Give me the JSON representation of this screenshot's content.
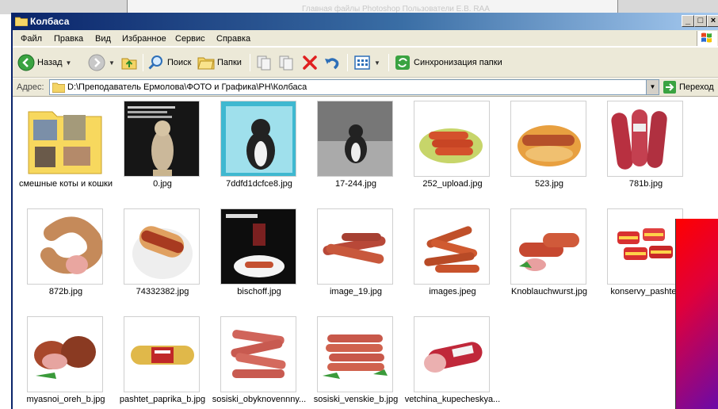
{
  "window": {
    "title": "Колбаса",
    "min_label": "_",
    "max_label": "□",
    "close_label": "×"
  },
  "background": {
    "ghost_text": "Главная    файлы    Photoshop    Пользователи    Е.В.    RAA"
  },
  "menu": [
    "Файл",
    "Правка",
    "Вид",
    "Избранное",
    "Сервис",
    "Справка"
  ],
  "toolbar": {
    "back": "Назад",
    "search": "Поиск",
    "folders": "Папки",
    "sync": "Синхронизация папки"
  },
  "address": {
    "label": "Адрес:",
    "path": "D:\\Преподаватель Ермолова\\ФОТО и Графика\\РН\\Колбаса",
    "go": "Переход"
  },
  "files": [
    {
      "name": "смешные коты и кошки",
      "kind": "folder"
    },
    {
      "name": "0.jpg",
      "kind": "cat-text"
    },
    {
      "name": "7ddfd1dcfce8.jpg",
      "kind": "cat-teal"
    },
    {
      "name": "17-244.jpg",
      "kind": "cat-bw"
    },
    {
      "name": "252_upload.jpg",
      "kind": "sausage-plate"
    },
    {
      "name": "523.jpg",
      "kind": "hotdog-dish"
    },
    {
      "name": "781b.jpg",
      "kind": "salami-tubes"
    },
    {
      "name": "872b.jpg",
      "kind": "ring-sausage"
    },
    {
      "name": "74332382.jpg",
      "kind": "hotdog"
    },
    {
      "name": "bischoff.jpg",
      "kind": "menu"
    },
    {
      "name": "image_19.jpg",
      "kind": "sausages"
    },
    {
      "name": "images.jpeg",
      "kind": "sausage-pile"
    },
    {
      "name": "Knoblauchwurst.jpg",
      "kind": "wurst"
    },
    {
      "name": "konservy_pashtet.",
      "kind": "cans"
    },
    {
      "name": "myasnoi_oreh_b.jpg",
      "kind": "ham"
    },
    {
      "name": "pashtet_paprika_b.jpg",
      "kind": "pate"
    },
    {
      "name": "sosiski_obyknovennny...",
      "kind": "frank-square"
    },
    {
      "name": "sosiski_venskie_b.jpg",
      "kind": "frank-stack"
    },
    {
      "name": "vetchina_kupecheskya...",
      "kind": "vetchina"
    }
  ]
}
